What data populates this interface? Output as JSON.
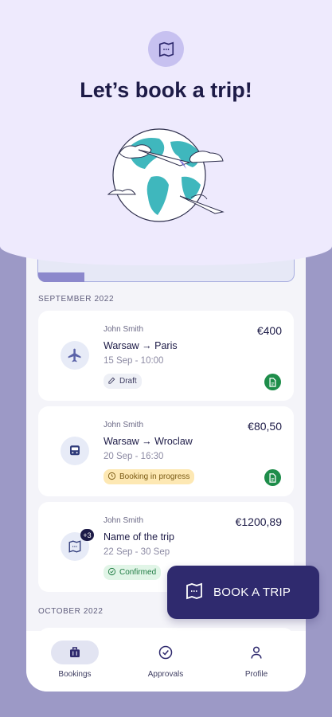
{
  "header": {
    "title": "Let’s book a trip!",
    "icon": "map-icon"
  },
  "sections": [
    {
      "label": "SEPTEMBER 2022"
    },
    {
      "label": "OCTOBER 2022"
    }
  ],
  "bookings": [
    {
      "traveler": "John Smith",
      "route": "Warsaw → Paris",
      "date": "15 Sep - 10:00",
      "price": "€400",
      "status": "Draft",
      "type_icon": "plane-icon",
      "status_icon": "pencil-icon",
      "has_document": true
    },
    {
      "traveler": "John Smith",
      "route": "Warsaw → Wroclaw",
      "date": "20 Sep - 16:30",
      "price": "€80,50",
      "status": "Booking in progress",
      "type_icon": "train-icon",
      "status_icon": "clock-icon",
      "has_document": true
    },
    {
      "traveler": "John Smith",
      "route": "Name of the trip",
      "date": "22 Sep - 30 Sep",
      "price": "€1200,89",
      "status": "Confirmed",
      "type_icon": "map-icon",
      "status_icon": "check-circle-icon",
      "count_badge": "+3",
      "has_document": false
    }
  ],
  "fab": {
    "label": "BOOK A TRIP",
    "icon": "map-icon"
  },
  "nav": [
    {
      "label": "Bookings",
      "icon": "suitcase-icon",
      "active": true
    },
    {
      "label": "Approvals",
      "icon": "check-circle-icon",
      "active": false
    },
    {
      "label": "Profile",
      "icon": "person-icon",
      "active": false
    }
  ],
  "colors": {
    "primary": "#2f2a6e",
    "header_bg": "#eeeafd",
    "page_bg": "#9c99c6",
    "success": "#1e8d4a",
    "warning_bg": "#fde8b3"
  }
}
